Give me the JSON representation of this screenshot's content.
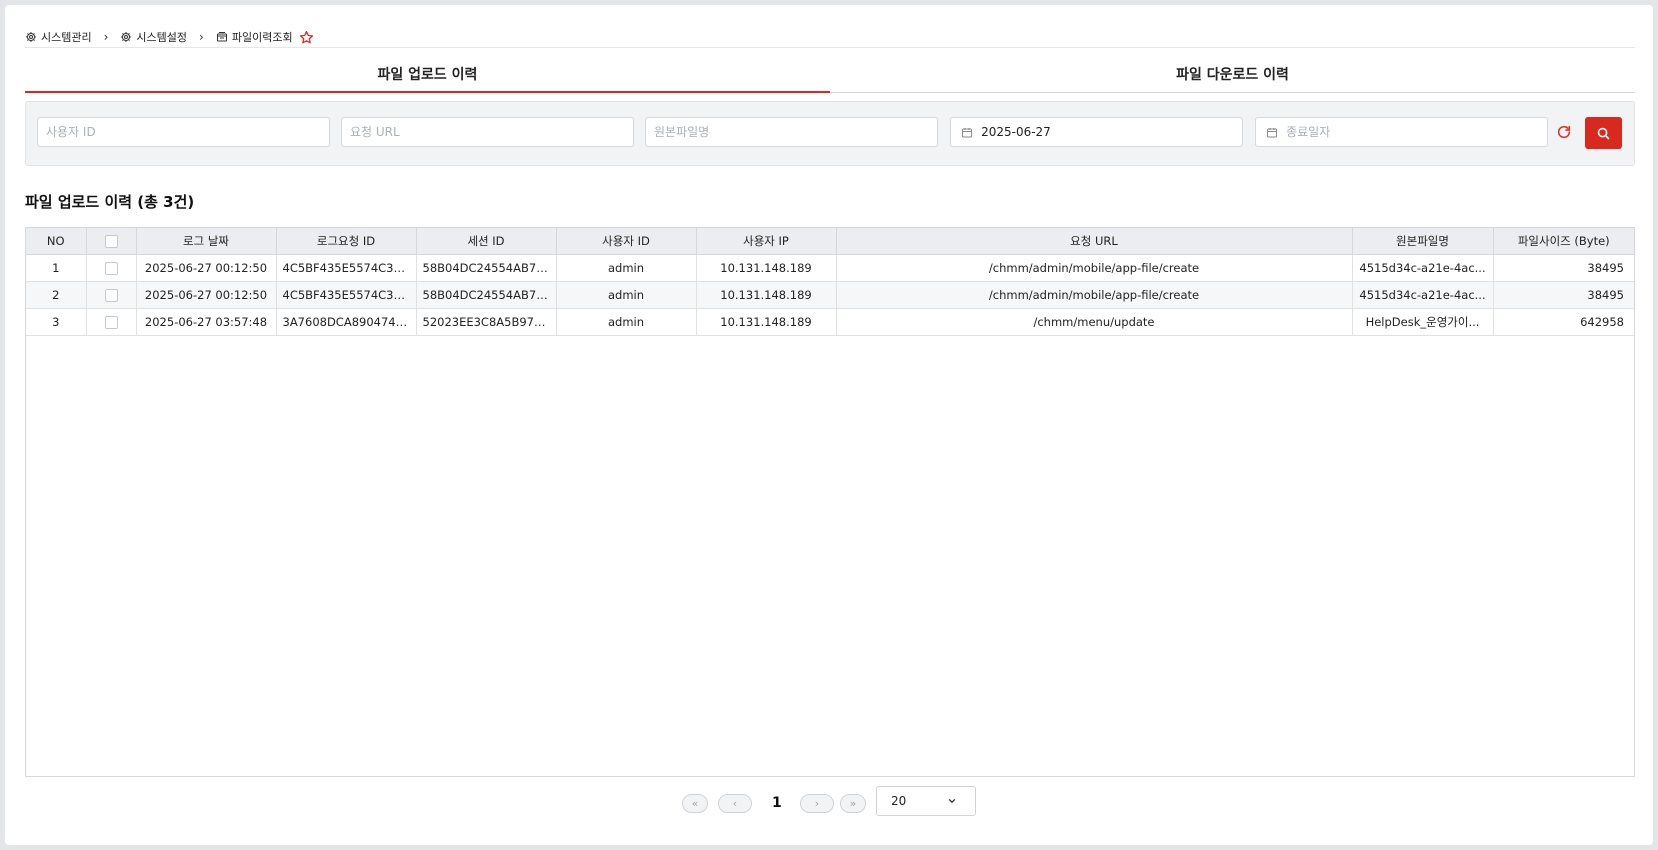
{
  "breadcrumb": {
    "items": [
      {
        "label": "시스템관리",
        "icon": "gear-icon"
      },
      {
        "label": "시스템설정",
        "icon": "gear-icon"
      },
      {
        "label": "파일이력조회",
        "icon": "archive-icon"
      }
    ],
    "favorite_icon": "star-outline-icon"
  },
  "tabs": [
    {
      "label": "파일 업로드 이력",
      "active": true
    },
    {
      "label": "파일 다운로드 이력",
      "active": false
    }
  ],
  "search": {
    "user_id_placeholder": "사용자 ID",
    "url_placeholder": "요청 URL",
    "filename_placeholder": "원본파일명",
    "start_date_value": "2025-06-27",
    "end_date_placeholder": "종료일자"
  },
  "list_title": "파일 업로드 이력 (총 3건)",
  "table": {
    "columns": [
      "NO",
      "",
      "로그 날짜",
      "로그요청 ID",
      "세션 ID",
      "사용자 ID",
      "사용자 IP",
      "요청 URL",
      "원본파일명",
      "파일사이즈 (Byte)"
    ],
    "rows": [
      {
        "no": "1",
        "date": "2025-06-27 00:12:50",
        "log_id": "4C5BF435E5574C39...",
        "session_id": "58B04DC24554AB70...",
        "user_id": "admin",
        "ip": "10.131.148.189",
        "url": "/chmm/admin/mobile/app-file/create",
        "filename": "4515d34c-a21e-4ac...",
        "size": "38495"
      },
      {
        "no": "2",
        "date": "2025-06-27 00:12:50",
        "log_id": "4C5BF435E5574C39...",
        "session_id": "58B04DC24554AB70...",
        "user_id": "admin",
        "ip": "10.131.148.189",
        "url": "/chmm/admin/mobile/app-file/create",
        "filename": "4515d34c-a21e-4ac...",
        "size": "38495"
      },
      {
        "no": "3",
        "date": "2025-06-27 03:57:48",
        "log_id": "3A7608DCA8904749...",
        "session_id": "52023EE3C8A5B97F...",
        "user_id": "admin",
        "ip": "10.131.148.189",
        "url": "/chmm/menu/update",
        "filename": "HelpDesk_운영가이...",
        "size": "642958"
      }
    ]
  },
  "pagination": {
    "current_page": "1",
    "page_size": "20"
  },
  "colors": {
    "accent": "#d9281e",
    "header_bg": "#ebedf0",
    "search_bg": "#f2f3f5"
  }
}
